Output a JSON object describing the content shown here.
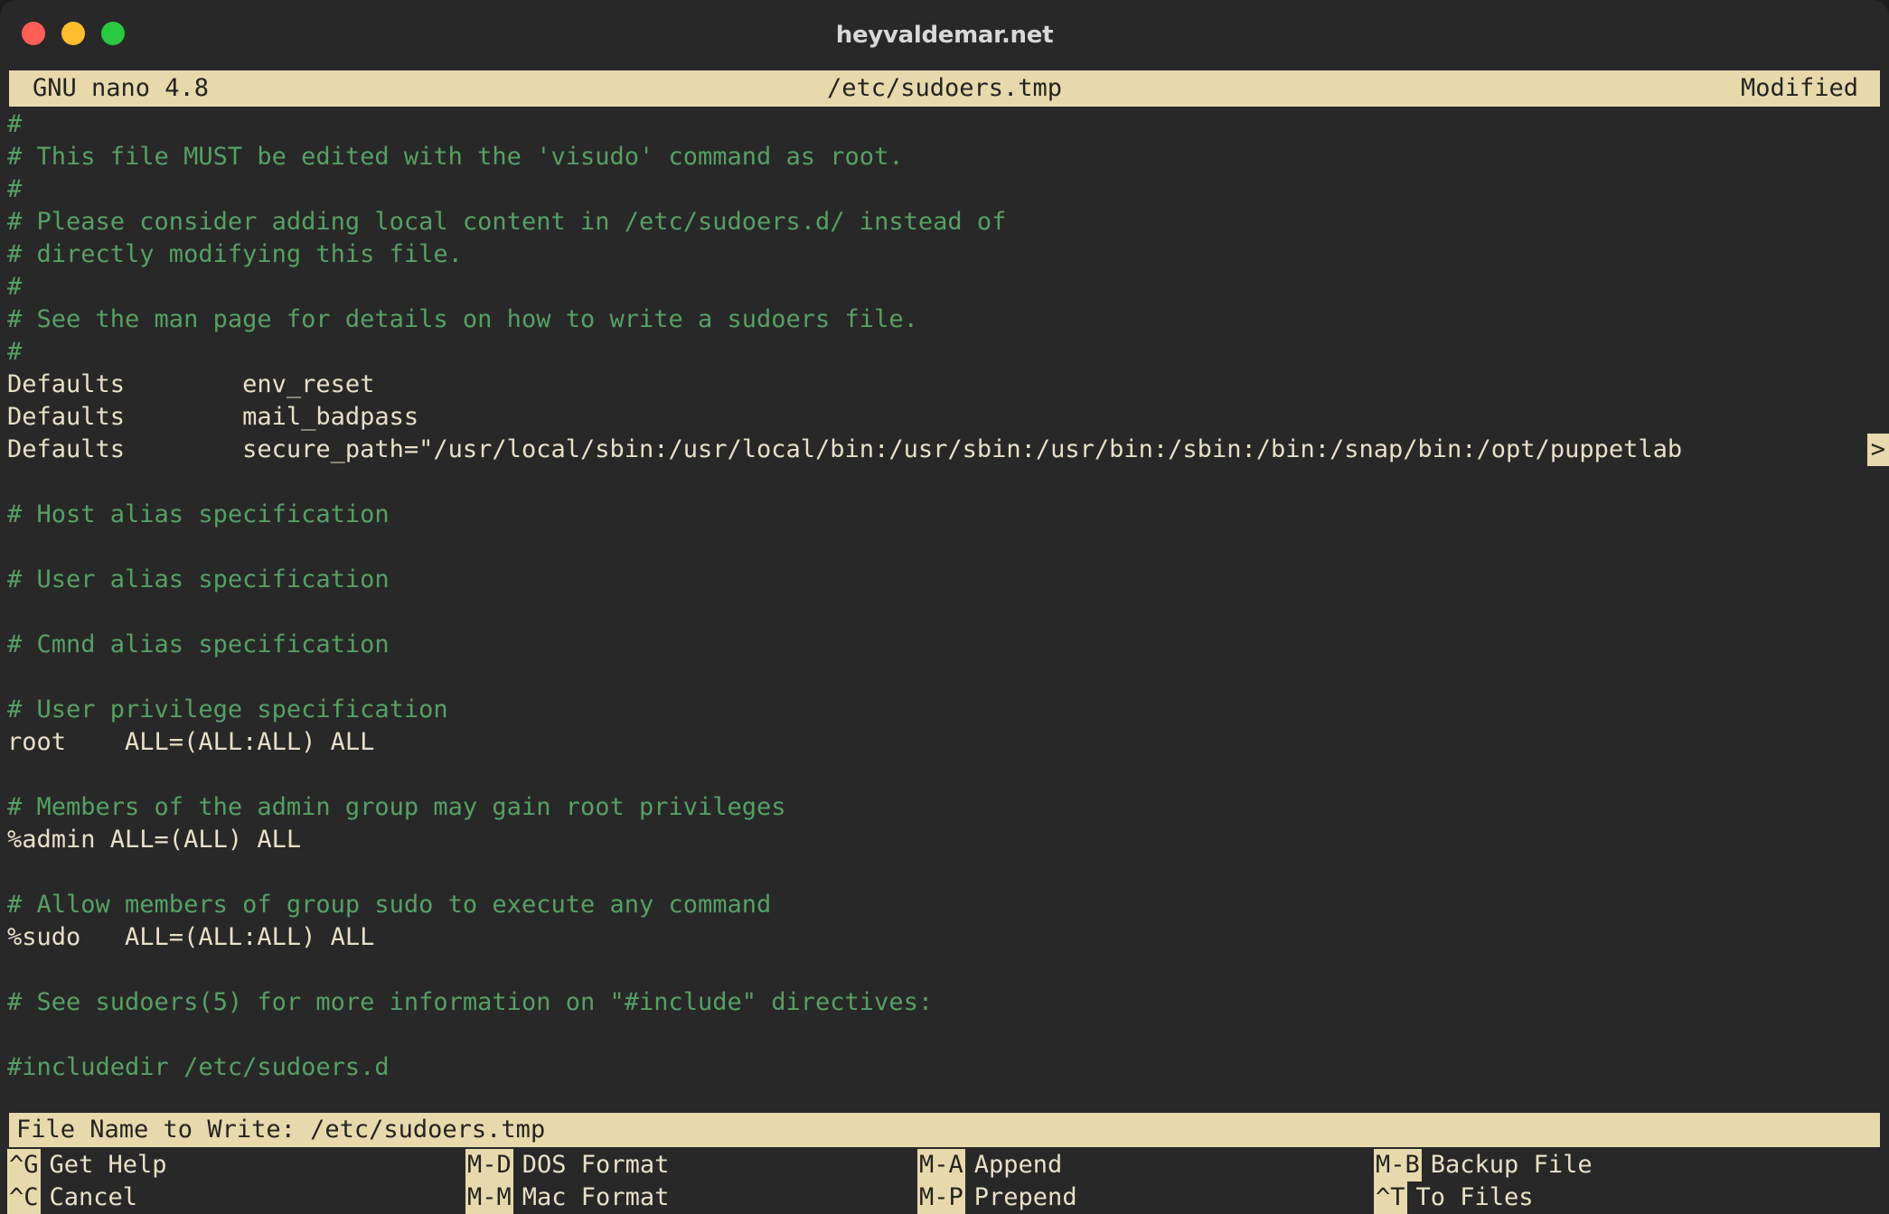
{
  "window": {
    "title": "heyvaldemar.net",
    "controls": [
      {
        "name": "close",
        "color": "#ff5f57"
      },
      {
        "name": "minimize",
        "color": "#febc2e"
      },
      {
        "name": "maximize",
        "color": "#28c840"
      }
    ]
  },
  "nano_header": {
    "version": "GNU nano 4.8",
    "filename": "/etc/sudoers.tmp",
    "state": "Modified"
  },
  "editor": {
    "lines": [
      {
        "text": "#",
        "type": "comment"
      },
      {
        "text": "# This file MUST be edited with the 'visudo' command as root.",
        "type": "comment"
      },
      {
        "text": "#",
        "type": "comment"
      },
      {
        "text": "# Please consider adding local content in /etc/sudoers.d/ instead of",
        "type": "comment"
      },
      {
        "text": "# directly modifying this file.",
        "type": "comment"
      },
      {
        "text": "#",
        "type": "comment"
      },
      {
        "text": "# See the man page for details on how to write a sudoers file.",
        "type": "comment"
      },
      {
        "text": "#",
        "type": "comment"
      },
      {
        "text": "Defaults        env_reset",
        "type": "code"
      },
      {
        "text": "Defaults        mail_badpass",
        "type": "code"
      },
      {
        "text": "Defaults        secure_path=\"/usr/local/sbin:/usr/local/bin:/usr/sbin:/usr/bin:/sbin:/bin:/snap/bin:/opt/puppetlab",
        "type": "code",
        "continuation": ">"
      },
      {
        "text": "",
        "type": "blank"
      },
      {
        "text": "# Host alias specification",
        "type": "comment"
      },
      {
        "text": "",
        "type": "blank"
      },
      {
        "text": "# User alias specification",
        "type": "comment"
      },
      {
        "text": "",
        "type": "blank"
      },
      {
        "text": "# Cmnd alias specification",
        "type": "comment"
      },
      {
        "text": "",
        "type": "blank"
      },
      {
        "text": "# User privilege specification",
        "type": "comment"
      },
      {
        "text": "root    ALL=(ALL:ALL) ALL",
        "type": "code"
      },
      {
        "text": "",
        "type": "blank"
      },
      {
        "text": "# Members of the admin group may gain root privileges",
        "type": "comment"
      },
      {
        "text": "%admin ALL=(ALL) ALL",
        "type": "code"
      },
      {
        "text": "",
        "type": "blank"
      },
      {
        "text": "# Allow members of group sudo to execute any command",
        "type": "comment"
      },
      {
        "text": "%sudo   ALL=(ALL:ALL) ALL",
        "type": "code"
      },
      {
        "text": "",
        "type": "blank"
      },
      {
        "text": "# See sudoers(5) for more information on \"#include\" directives:",
        "type": "comment"
      },
      {
        "text": "",
        "type": "blank"
      },
      {
        "text": "#includedir /etc/sudoers.d",
        "type": "comment"
      }
    ]
  },
  "prompt": {
    "text": "File Name to Write: /etc/sudoers.tmp",
    "label": "File Name to Write:",
    "value": "/etc/sudoers.tmp"
  },
  "shortcuts": {
    "row1": [
      {
        "key": "^G",
        "label": "Get Help"
      },
      {
        "key": "M-D",
        "label": "DOS Format"
      },
      {
        "key": "M-A",
        "label": "Append"
      },
      {
        "key": "M-B",
        "label": "Backup File"
      }
    ],
    "row2": [
      {
        "key": "^C",
        "label": "Cancel"
      },
      {
        "key": "M-M",
        "label": "Mac Format"
      },
      {
        "key": "M-P",
        "label": "Prepend"
      },
      {
        "key": "^T",
        "label": "To Files"
      }
    ]
  },
  "colors": {
    "window_bg": "#282828",
    "highlight_bg": "#e8d9ad",
    "highlight_fg": "#24241f",
    "comment_fg": "#56a064",
    "code_fg": "#e8e0c8",
    "title_fg": "#d8d8d8"
  }
}
